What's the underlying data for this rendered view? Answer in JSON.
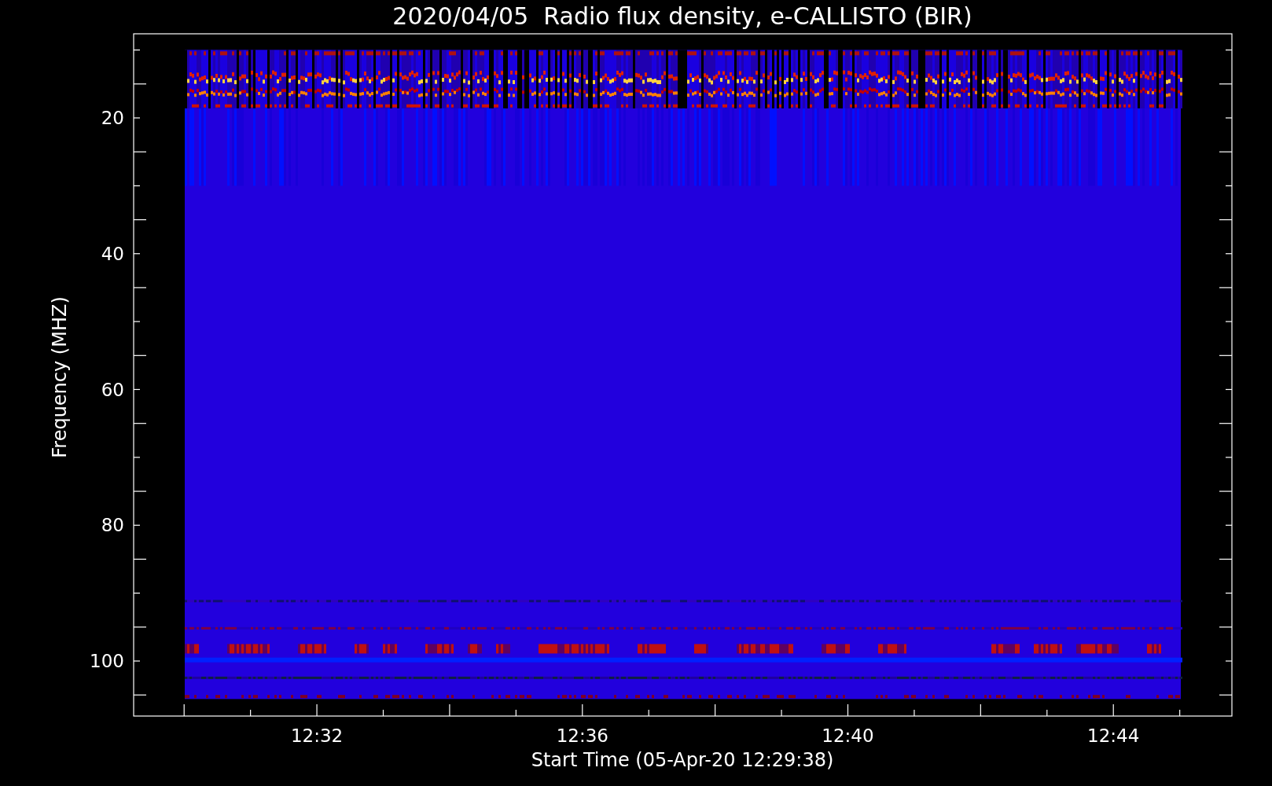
{
  "title": "2020/04/05  Radio flux density, e-CALLISTO (BIR)",
  "y_axis": {
    "label": "Frequency (MHZ)",
    "ticks": [
      "20",
      "40",
      "60",
      "80",
      "100"
    ]
  },
  "x_axis": {
    "label": "Start Time (05-Apr-20 12:29:38)",
    "ticks": [
      "12:32",
      "12:36",
      "12:40",
      "12:44"
    ]
  }
}
